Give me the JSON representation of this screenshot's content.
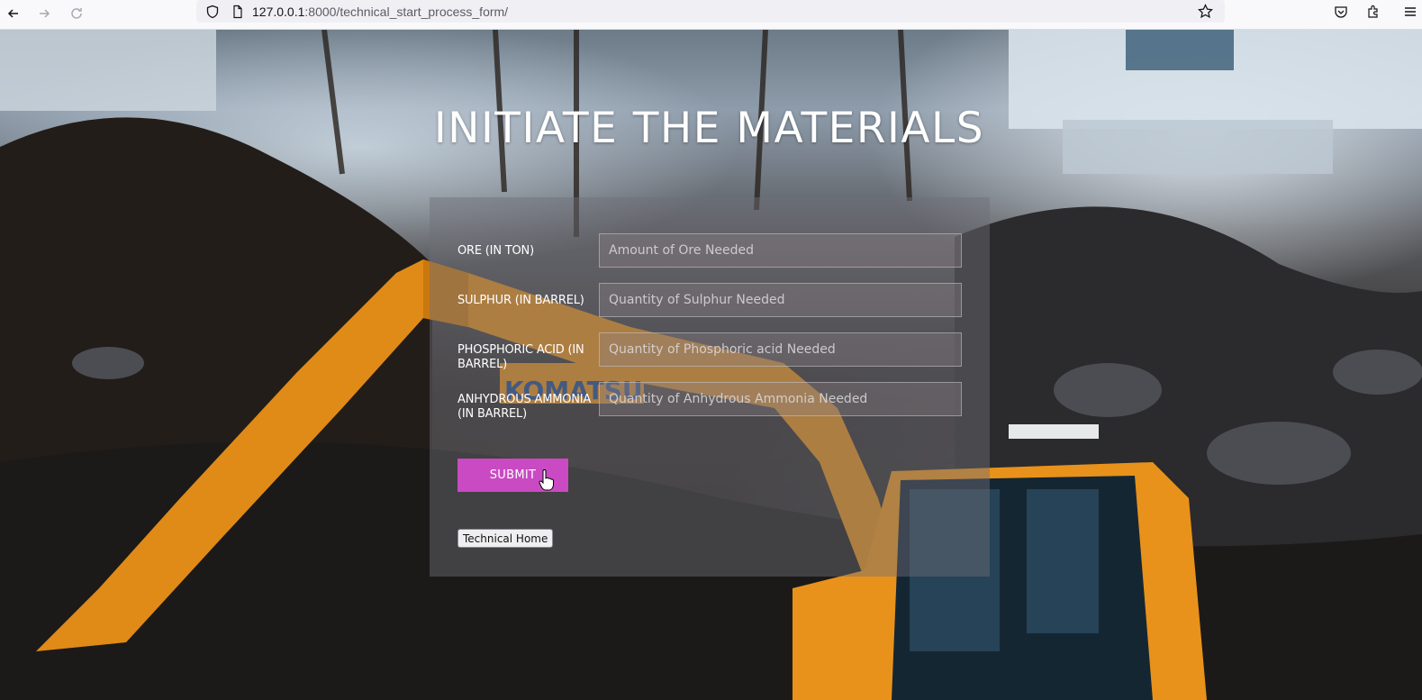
{
  "browser": {
    "url_host": "127.0.0.1",
    "url_rest": ":8000/technical_start_process_form/"
  },
  "page": {
    "title": "INITIATE THE MATERIALS"
  },
  "form": {
    "fields": [
      {
        "label": "ORE (IN TON)",
        "placeholder": "Amount of Ore Needed",
        "value": ""
      },
      {
        "label": "SULPHUR (IN BARREL)",
        "placeholder": "Quantity of Sulphur Needed",
        "value": ""
      },
      {
        "label": "PHOSPHORIC ACID (IN BARREL)",
        "placeholder": "Quantity of Phosphoric acid Needed",
        "value": ""
      },
      {
        "label": "ANHYDROUS AMMONIA (IN BARREL)",
        "placeholder": "Quantity of Anhydrous Ammonia Needed",
        "value": ""
      }
    ],
    "submit_label": "SUBMIT",
    "home_label": "Technical Home"
  },
  "colors": {
    "submit_bg": "#c94ac3",
    "heading_text": "#ffffff"
  }
}
